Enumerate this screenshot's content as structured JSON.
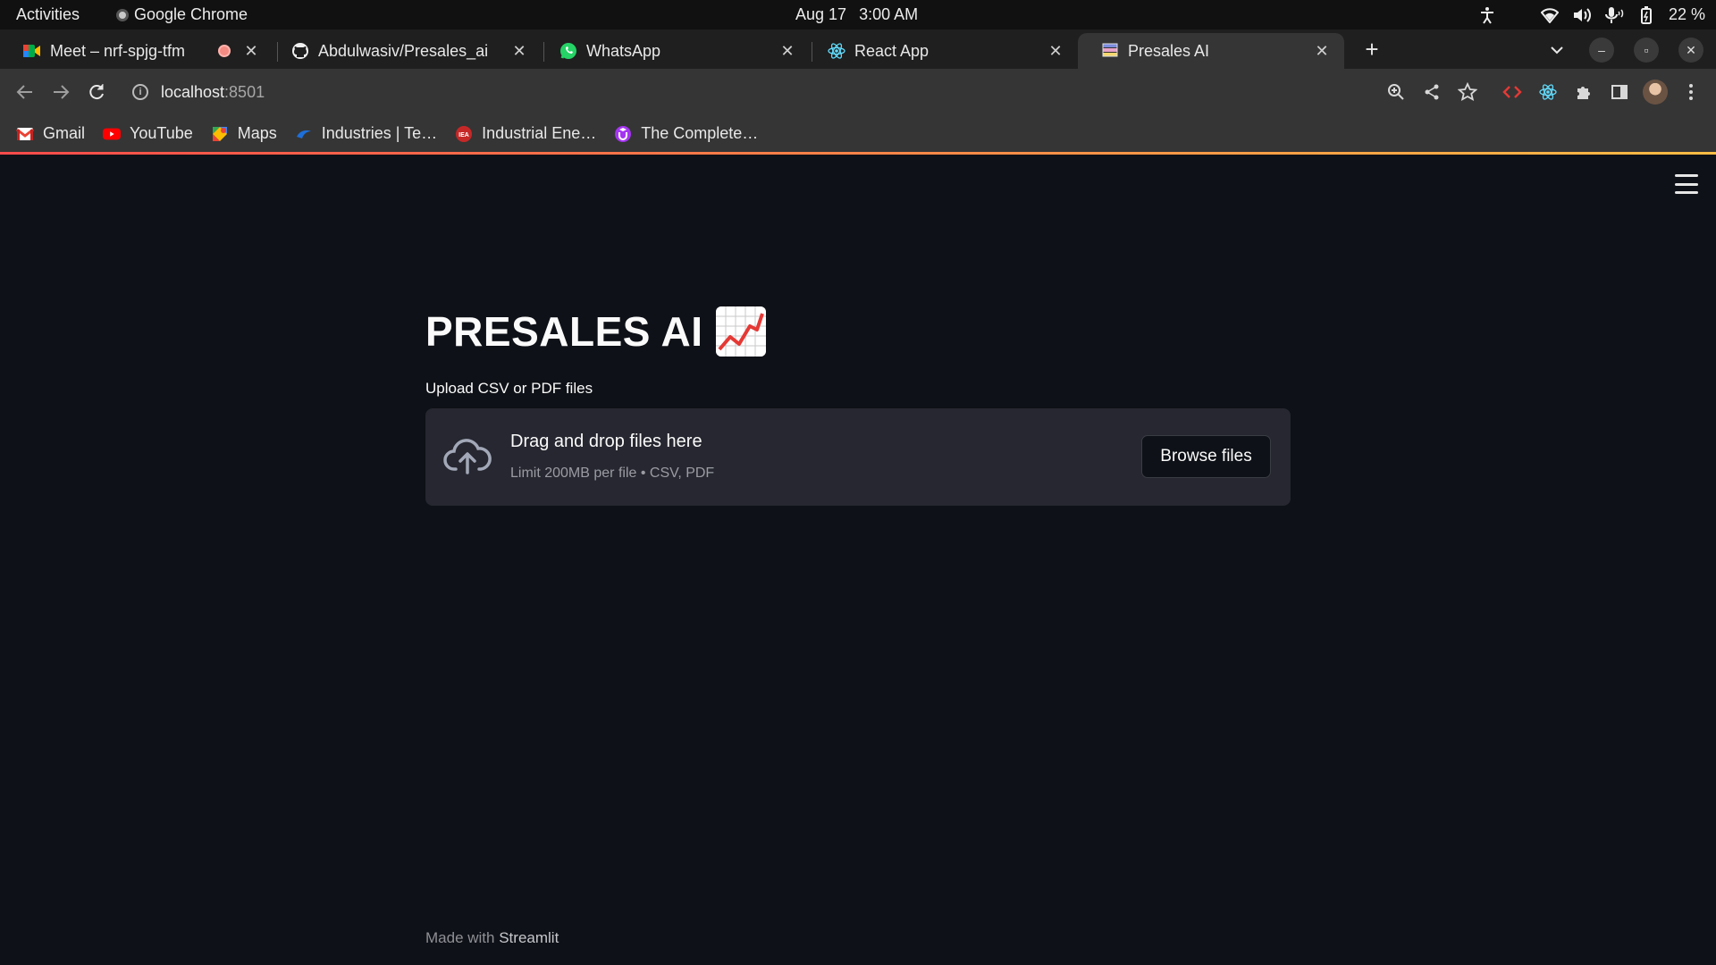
{
  "system_bar": {
    "activities": "Activities",
    "app_name": "Google Chrome",
    "date": "Aug 17",
    "time": "3:00 AM",
    "battery": "22 %"
  },
  "tabs": [
    {
      "title": "Meet – nrf-spjg-tfm",
      "icon": "google-meet-icon",
      "recording": true
    },
    {
      "title": "Abdulwasiv/Presales_ai",
      "icon": "github-icon"
    },
    {
      "title": "WhatsApp",
      "icon": "whatsapp-icon"
    },
    {
      "title": "React App",
      "icon": "react-icon"
    },
    {
      "title": "Presales AI",
      "icon": "streamlit-icon",
      "active": true
    }
  ],
  "address_bar": {
    "host": "localhost",
    "port": ":8501"
  },
  "bookmarks": [
    {
      "label": "Gmail",
      "icon": "gmail-icon"
    },
    {
      "label": "YouTube",
      "icon": "youtube-icon"
    },
    {
      "label": "Maps",
      "icon": "maps-icon"
    },
    {
      "label": "Industries | Te…",
      "icon": "site-icon"
    },
    {
      "label": "Industrial Ene…",
      "icon": "site-red-icon"
    },
    {
      "label": "The Complete…",
      "icon": "site-purple-icon"
    }
  ],
  "app": {
    "title": "PRESALES AI",
    "title_emoji": "chart-increasing-icon",
    "uploader": {
      "label": "Upload CSV or PDF files",
      "drop_title": "Drag and drop files here",
      "drop_hint": "Limit 200MB per file • CSV, PDF",
      "browse_label": "Browse files"
    },
    "footer": {
      "prefix": "Made with",
      "brand": "Streamlit"
    }
  },
  "colors": {
    "background": "#0e1117",
    "dropzone": "#262730",
    "accent_start": "#ff4b4b",
    "accent_end": "#ffbd45"
  }
}
